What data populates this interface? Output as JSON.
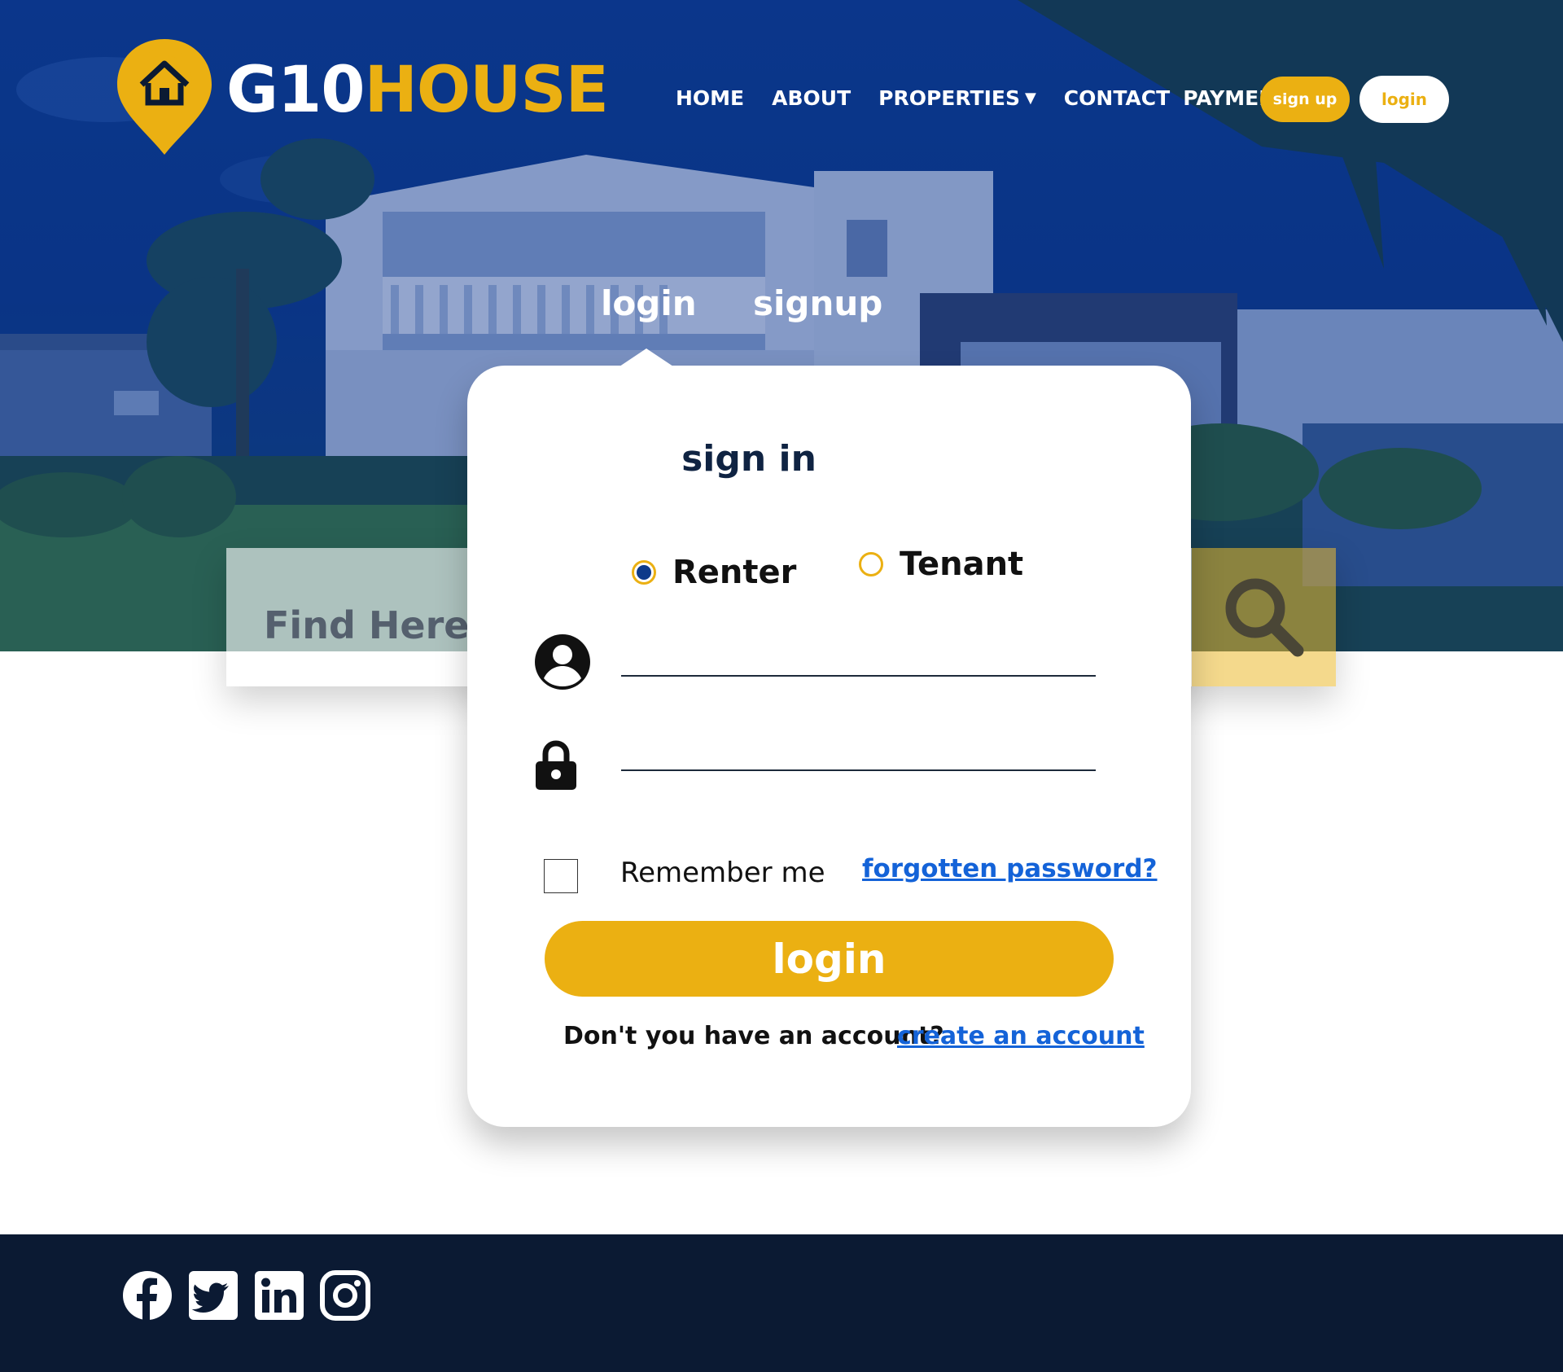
{
  "brand": {
    "part1": "G10",
    "part2": "HOUSE",
    "accent": "#ebb012",
    "navy": "#0d3a8a"
  },
  "nav": {
    "items": [
      {
        "label": "HOME",
        "dropdown": false
      },
      {
        "label": "ABOUT",
        "dropdown": false
      },
      {
        "label": "PROPERTIES",
        "dropdown": true
      },
      {
        "label": "CONTACT",
        "dropdown": false
      },
      {
        "label": "PAYMENT",
        "dropdown": true
      }
    ],
    "signup_label": "sign up",
    "login_label": "login"
  },
  "auth_tabs": {
    "login": "login",
    "signup": "signup",
    "active": "login"
  },
  "search": {
    "placeholder": "Find Here",
    "icon": "search-icon"
  },
  "card": {
    "title": "sign in",
    "roles": [
      {
        "label": "Renter",
        "selected": true
      },
      {
        "label": "Tenant",
        "selected": false
      }
    ],
    "username": {
      "value": "",
      "icon": "user-icon"
    },
    "password": {
      "value": "",
      "icon": "lock-icon"
    },
    "remember_label": "Remember me",
    "remember_checked": false,
    "forgot_label": "forgotten password?",
    "login_button": "login",
    "no_account_text": "Don't you have an account?",
    "create_account_label": "create an account"
  },
  "footer": {
    "social": [
      "facebook-icon",
      "twitter-icon",
      "linkedin-icon",
      "instagram-icon"
    ]
  }
}
